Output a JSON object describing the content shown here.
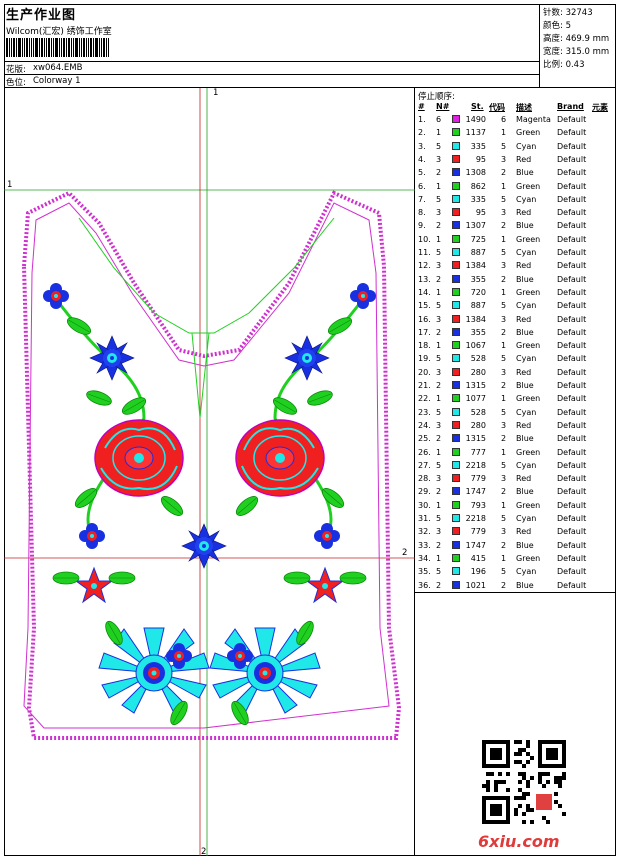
{
  "header": {
    "title": "生产作业图",
    "company": "Wilcom(汇宏) 绣饰工作室",
    "design_label": "花版:",
    "design_value": "xw064.EMB",
    "colorway_label": "色位:",
    "colorway_value": "Colorway 1"
  },
  "stats": {
    "stitches": "针数: 32743",
    "colors": "颜色: 5",
    "height": "高度: 469.9 mm",
    "width": "宽度: 315.0 mm",
    "scale": "比例: 0.43"
  },
  "canvas": {
    "marker_top": "1",
    "marker_left": "1",
    "marker_right": "2",
    "marker_bottom": "2"
  },
  "stop_sequence": {
    "title": "停止顺序:",
    "headers": {
      "num": "#",
      "needle": "N#",
      "stitches": "St.",
      "code": "代码",
      "desc": "描述",
      "brand": "Brand",
      "element": "元素"
    },
    "rows": [
      {
        "num": "1.",
        "n": "6",
        "color": "#e020e0",
        "st": "1490",
        "code": "6",
        "desc": "Magenta",
        "brand": "Default"
      },
      {
        "num": "2.",
        "n": "1",
        "color": "#20d020",
        "st": "1137",
        "code": "1",
        "desc": "Green",
        "brand": "Default"
      },
      {
        "num": "3.",
        "n": "5",
        "color": "#20e8e8",
        "st": "335",
        "code": "5",
        "desc": "Cyan",
        "brand": "Default"
      },
      {
        "num": "4.",
        "n": "3",
        "color": "#f02020",
        "st": "95",
        "code": "3",
        "desc": "Red",
        "brand": "Default"
      },
      {
        "num": "5.",
        "n": "2",
        "color": "#1830e0",
        "st": "1308",
        "code": "2",
        "desc": "Blue",
        "brand": "Default"
      },
      {
        "num": "6.",
        "n": "1",
        "color": "#20d020",
        "st": "862",
        "code": "1",
        "desc": "Green",
        "brand": "Default"
      },
      {
        "num": "7.",
        "n": "5",
        "color": "#20e8e8",
        "st": "335",
        "code": "5",
        "desc": "Cyan",
        "brand": "Default"
      },
      {
        "num": "8.",
        "n": "3",
        "color": "#f02020",
        "st": "95",
        "code": "3",
        "desc": "Red",
        "brand": "Default"
      },
      {
        "num": "9.",
        "n": "2",
        "color": "#1830e0",
        "st": "1307",
        "code": "2",
        "desc": "Blue",
        "brand": "Default"
      },
      {
        "num": "10.",
        "n": "1",
        "color": "#20d020",
        "st": "725",
        "code": "1",
        "desc": "Green",
        "brand": "Default"
      },
      {
        "num": "11.",
        "n": "5",
        "color": "#20e8e8",
        "st": "887",
        "code": "5",
        "desc": "Cyan",
        "brand": "Default"
      },
      {
        "num": "12.",
        "n": "3",
        "color": "#f02020",
        "st": "1384",
        "code": "3",
        "desc": "Red",
        "brand": "Default"
      },
      {
        "num": "13.",
        "n": "2",
        "color": "#1830e0",
        "st": "355",
        "code": "2",
        "desc": "Blue",
        "brand": "Default"
      },
      {
        "num": "14.",
        "n": "1",
        "color": "#20d020",
        "st": "720",
        "code": "1",
        "desc": "Green",
        "brand": "Default"
      },
      {
        "num": "15.",
        "n": "5",
        "color": "#20e8e8",
        "st": "887",
        "code": "5",
        "desc": "Cyan",
        "brand": "Default"
      },
      {
        "num": "16.",
        "n": "3",
        "color": "#f02020",
        "st": "1384",
        "code": "3",
        "desc": "Red",
        "brand": "Default"
      },
      {
        "num": "17.",
        "n": "2",
        "color": "#1830e0",
        "st": "355",
        "code": "2",
        "desc": "Blue",
        "brand": "Default"
      },
      {
        "num": "18.",
        "n": "1",
        "color": "#20d020",
        "st": "1067",
        "code": "1",
        "desc": "Green",
        "brand": "Default"
      },
      {
        "num": "19.",
        "n": "5",
        "color": "#20e8e8",
        "st": "528",
        "code": "5",
        "desc": "Cyan",
        "brand": "Default"
      },
      {
        "num": "20.",
        "n": "3",
        "color": "#f02020",
        "st": "280",
        "code": "3",
        "desc": "Red",
        "brand": "Default"
      },
      {
        "num": "21.",
        "n": "2",
        "color": "#1830e0",
        "st": "1315",
        "code": "2",
        "desc": "Blue",
        "brand": "Default"
      },
      {
        "num": "22.",
        "n": "1",
        "color": "#20d020",
        "st": "1077",
        "code": "1",
        "desc": "Green",
        "brand": "Default"
      },
      {
        "num": "23.",
        "n": "5",
        "color": "#20e8e8",
        "st": "528",
        "code": "5",
        "desc": "Cyan",
        "brand": "Default"
      },
      {
        "num": "24.",
        "n": "3",
        "color": "#f02020",
        "st": "280",
        "code": "3",
        "desc": "Red",
        "brand": "Default"
      },
      {
        "num": "25.",
        "n": "2",
        "color": "#1830e0",
        "st": "1315",
        "code": "2",
        "desc": "Blue",
        "brand": "Default"
      },
      {
        "num": "26.",
        "n": "1",
        "color": "#20d020",
        "st": "777",
        "code": "1",
        "desc": "Green",
        "brand": "Default"
      },
      {
        "num": "27.",
        "n": "5",
        "color": "#20e8e8",
        "st": "2218",
        "code": "5",
        "desc": "Cyan",
        "brand": "Default"
      },
      {
        "num": "28.",
        "n": "3",
        "color": "#f02020",
        "st": "779",
        "code": "3",
        "desc": "Red",
        "brand": "Default"
      },
      {
        "num": "29.",
        "n": "2",
        "color": "#1830e0",
        "st": "1747",
        "code": "2",
        "desc": "Blue",
        "brand": "Default"
      },
      {
        "num": "30.",
        "n": "1",
        "color": "#20d020",
        "st": "793",
        "code": "1",
        "desc": "Green",
        "brand": "Default"
      },
      {
        "num": "31.",
        "n": "5",
        "color": "#20e8e8",
        "st": "2218",
        "code": "5",
        "desc": "Cyan",
        "brand": "Default"
      },
      {
        "num": "32.",
        "n": "3",
        "color": "#f02020",
        "st": "779",
        "code": "3",
        "desc": "Red",
        "brand": "Default"
      },
      {
        "num": "33.",
        "n": "2",
        "color": "#1830e0",
        "st": "1747",
        "code": "2",
        "desc": "Blue",
        "brand": "Default"
      },
      {
        "num": "34.",
        "n": "1",
        "color": "#20d020",
        "st": "415",
        "code": "1",
        "desc": "Green",
        "brand": "Default"
      },
      {
        "num": "35.",
        "n": "5",
        "color": "#20e8e8",
        "st": "196",
        "code": "5",
        "desc": "Cyan",
        "brand": "Default"
      },
      {
        "num": "36.",
        "n": "2",
        "color": "#1830e0",
        "st": "1021",
        "code": "2",
        "desc": "Blue",
        "brand": "Default"
      }
    ]
  },
  "watermark": "6xiu.com"
}
